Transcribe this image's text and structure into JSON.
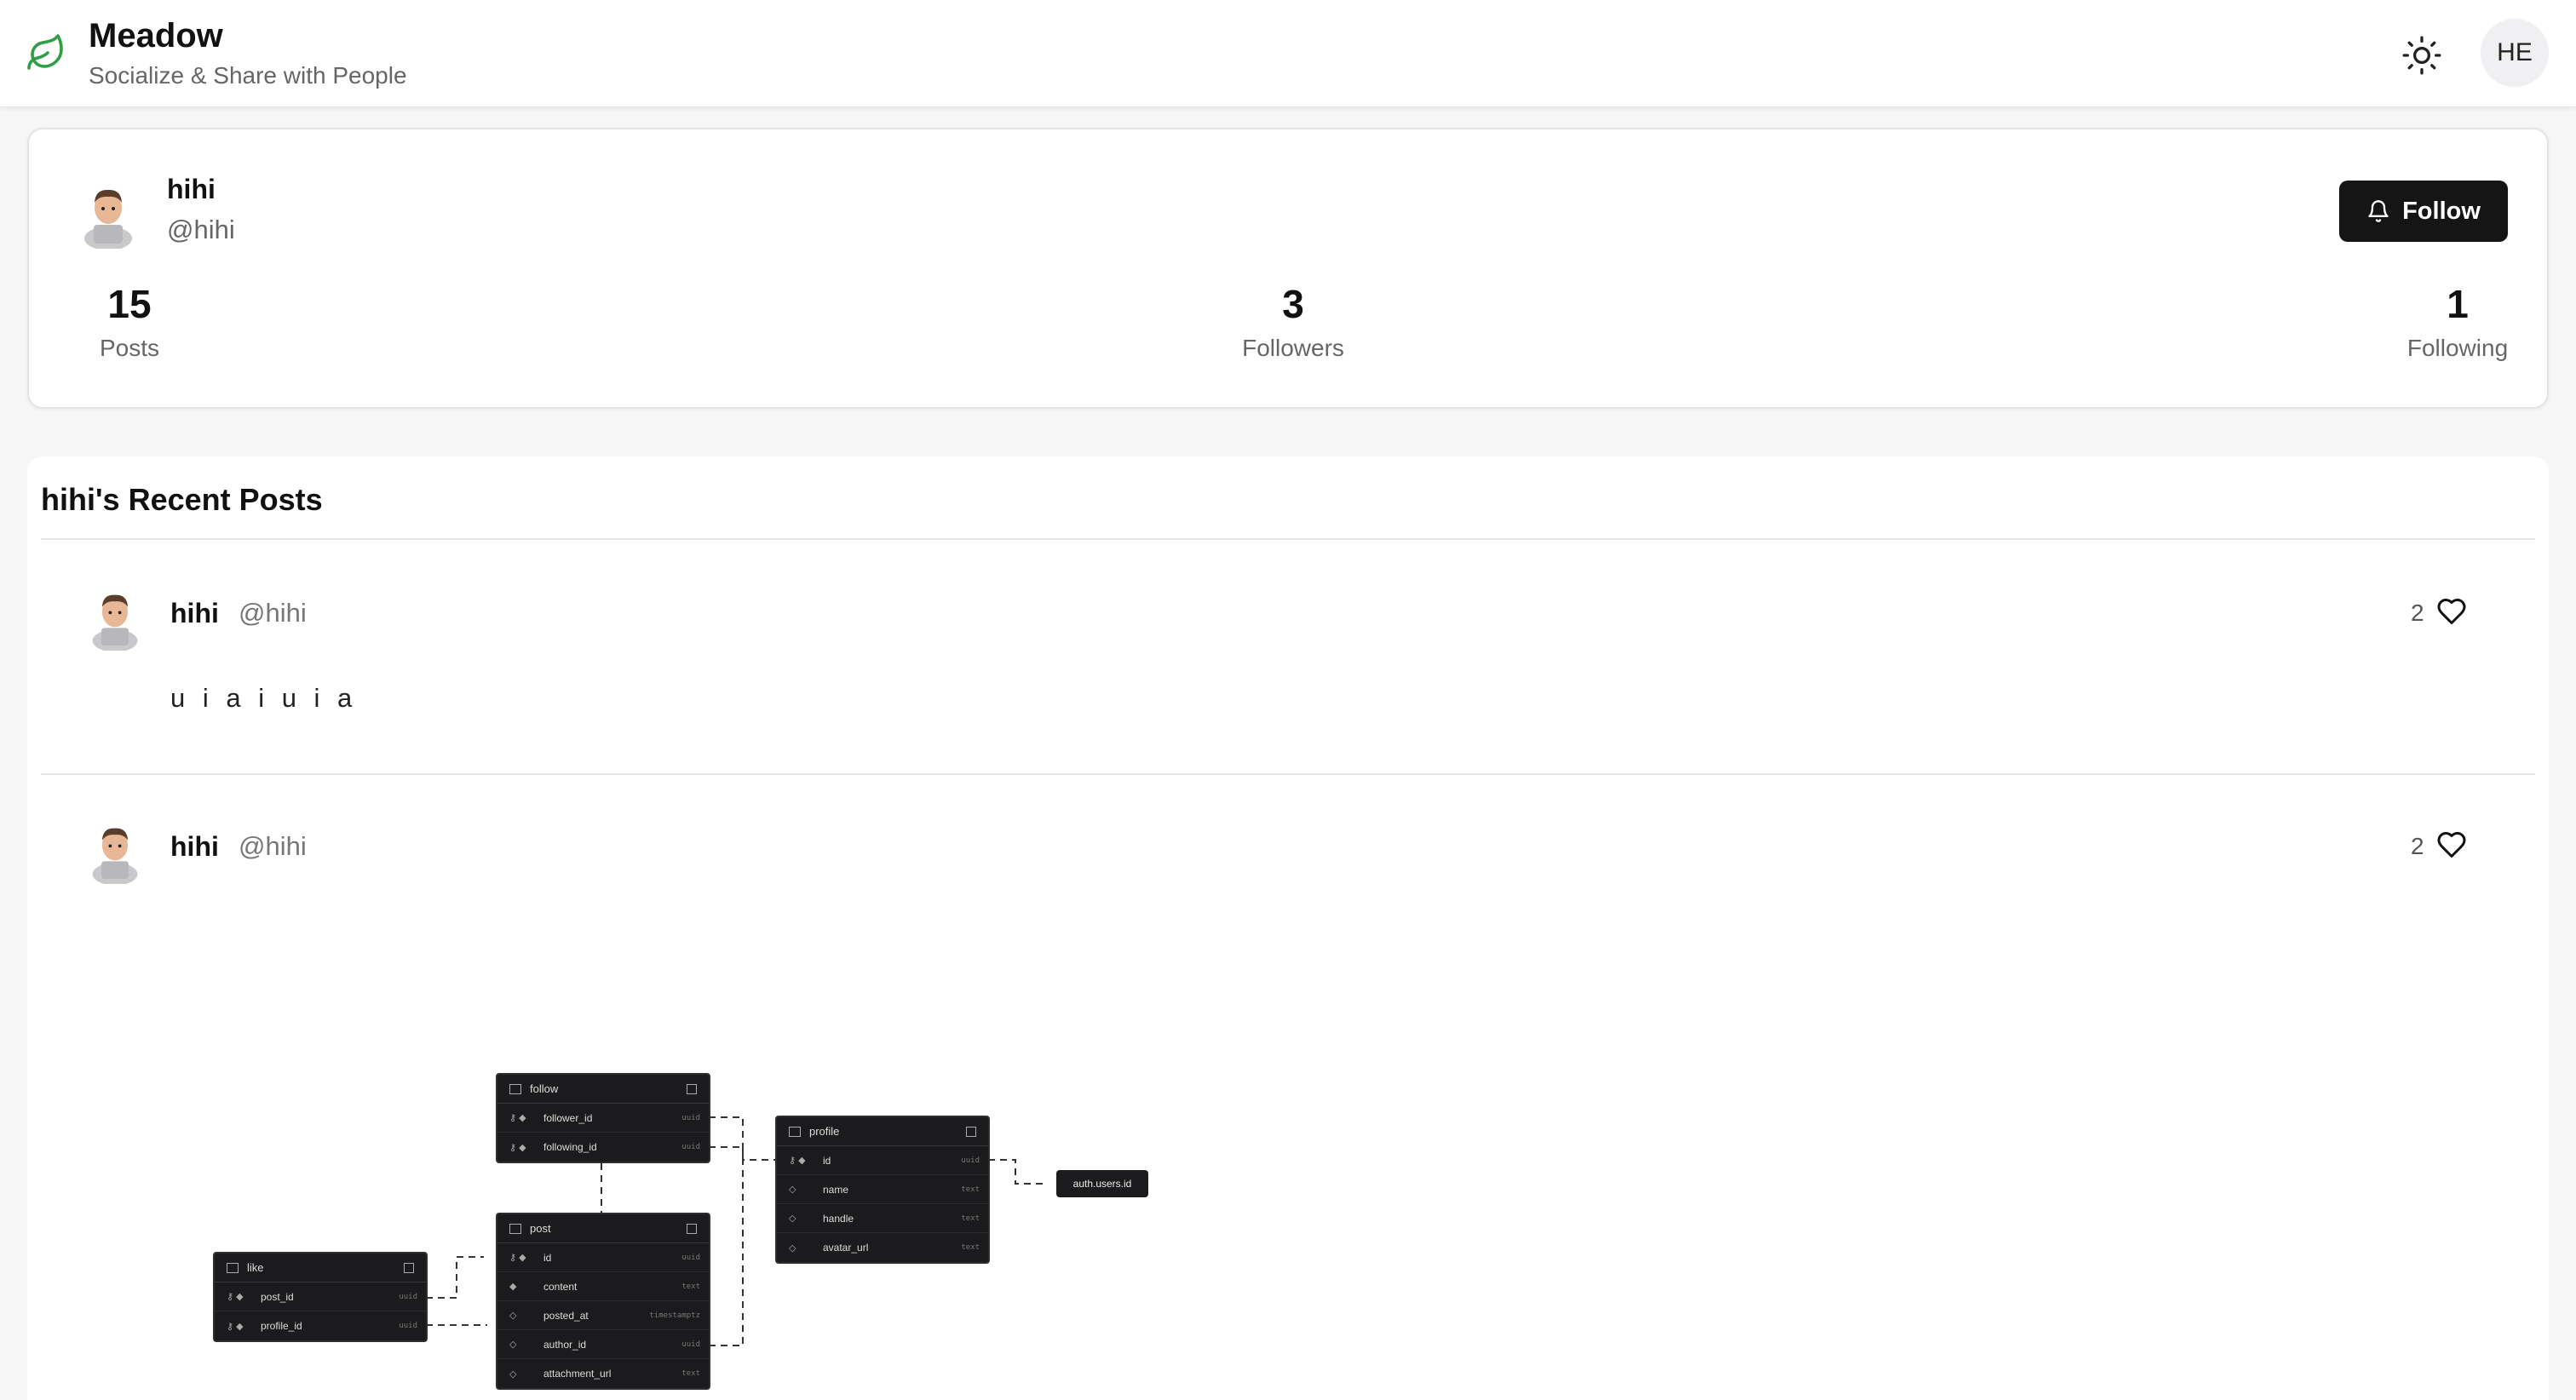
{
  "app": {
    "title": "Meadow",
    "subtitle": "Socialize & Share with People",
    "user_initials": "HE",
    "icons": {
      "logo": "leaf-icon",
      "theme": "sun-icon"
    },
    "accent": "#2f9e44"
  },
  "profile": {
    "name": "hihi",
    "handle": "@hihi",
    "follow_label": "Follow",
    "stats": {
      "posts": {
        "value": "15",
        "label": "Posts"
      },
      "followers": {
        "value": "3",
        "label": "Followers"
      },
      "following": {
        "value": "1",
        "label": "Following"
      }
    }
  },
  "posts_section": {
    "title": "hihi's Recent Posts",
    "posts": [
      {
        "name": "hihi",
        "handle": "@hihi",
        "likes": "2",
        "text": "u i a i u i a"
      },
      {
        "name": "hihi",
        "handle": "@hihi",
        "likes": "2",
        "text": ""
      }
    ]
  },
  "diagram": {
    "tables": {
      "follow": {
        "name": "follow",
        "rows": [
          {
            "col": "follower_id",
            "type": "uuid"
          },
          {
            "col": "following_id",
            "type": "uuid"
          }
        ]
      },
      "profile": {
        "name": "profile",
        "rows": [
          {
            "col": "id",
            "type": "uuid"
          },
          {
            "col": "name",
            "type": "text"
          },
          {
            "col": "handle",
            "type": "text"
          },
          {
            "col": "avatar_url",
            "type": "text"
          }
        ]
      },
      "post": {
        "name": "post",
        "rows": [
          {
            "col": "id",
            "type": "uuid"
          },
          {
            "col": "content",
            "type": "text"
          },
          {
            "col": "posted_at",
            "type": "timestamptz"
          },
          {
            "col": "author_id",
            "type": "uuid"
          },
          {
            "col": "attachment_url",
            "type": "text"
          }
        ]
      },
      "like": {
        "name": "like",
        "rows": [
          {
            "col": "post_id",
            "type": "uuid"
          },
          {
            "col": "profile_id",
            "type": "uuid"
          }
        ]
      }
    },
    "ref": "auth.users.id"
  }
}
